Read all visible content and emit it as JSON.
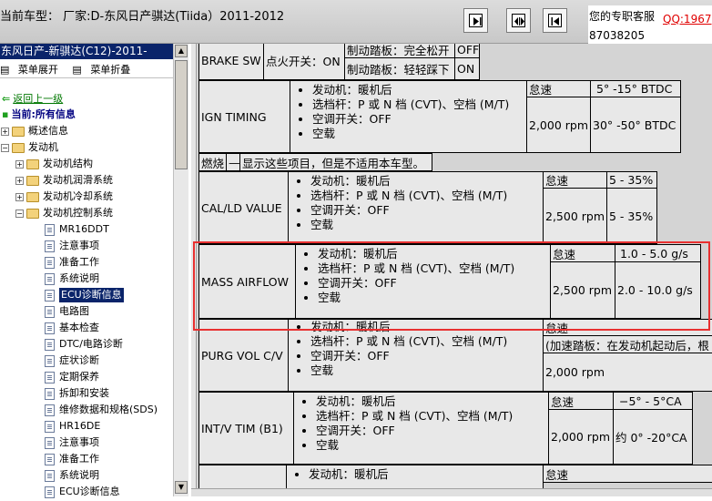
{
  "header": {
    "model_line": "当前车型：  厂家:D-东风日产骐达(Tiida）2011-2012",
    "service_label": "您的专职客服",
    "qq_text": "QQ:1967",
    "qq_number": "87038205",
    "nav_buttons": [
      "jump-next-icon",
      "jump-both-icon",
      "jump-prev-icon"
    ]
  },
  "sidebar": {
    "title": "东风日产-新骐达(C12)-2011-",
    "expand_all": "菜单展开",
    "collapse_all": "菜单折叠",
    "back_link": "返回上一级",
    "current_label": "当前:所有信息",
    "tree": [
      {
        "label": "概述信息"
      },
      {
        "label": "发动机"
      },
      {
        "label": "发动机结构"
      },
      {
        "label": "发动机润滑系统"
      },
      {
        "label": "发动机冷却系统"
      },
      {
        "label": "发动机控制系统"
      },
      {
        "label": "MR16DDT"
      },
      {
        "label": "注意事项"
      },
      {
        "label": "准备工作"
      },
      {
        "label": "系统说明"
      },
      {
        "label": "ECU诊断信息"
      },
      {
        "label": "电路图"
      },
      {
        "label": "基本检查"
      },
      {
        "label": "DTC/电路诊断"
      },
      {
        "label": "症状诊断"
      },
      {
        "label": "定期保养"
      },
      {
        "label": "拆卸和安装"
      },
      {
        "label": "维修数据和规格(SDS)"
      },
      {
        "label": "HR16DE"
      },
      {
        "label": "注意事项"
      },
      {
        "label": "准备工作"
      },
      {
        "label": "系统说明"
      },
      {
        "label": "ECU诊断信息"
      }
    ]
  },
  "content": {
    "brake_sw": {
      "item": "BRAKE SW",
      "condition": "点火开关：ON",
      "rows": [
        {
          "state": "制动踏板：完全松开",
          "value": "OFF"
        },
        {
          "state": "制动踏板：轻轻踩下",
          "value": "ON"
        }
      ]
    },
    "common_conditions": [
      "发动机：暖机后",
      "选档杆：P 或 N 档 (CVT)、空档 (M/T)",
      "空调开关：OFF",
      "空载"
    ],
    "ign_timing": {
      "item": "IGN TIMING",
      "rows": [
        {
          "cond": "怠速",
          "value": "5° -15° BTDC"
        },
        {
          "cond": "2,000 rpm",
          "value": "30° -50° BTDC"
        }
      ]
    },
    "combustion": {
      "label": "燃烧",
      "dash": "—",
      "note": "显示这些项目，但是不适用本车型。"
    },
    "cal_ld": {
      "item": "CAL/LD VALUE",
      "rows": [
        {
          "cond": "怠速",
          "value": "5 - 35%"
        },
        {
          "cond": "2,500 rpm",
          "value": "5 - 35%"
        }
      ]
    },
    "mass_airflow": {
      "item": "MASS AIRFLOW",
      "rows": [
        {
          "cond": "怠速",
          "value": "1.0 - 5.0 g/s"
        },
        {
          "cond": "2,500 rpm",
          "value": "2.0 - 10.0 g/s"
        }
      ]
    },
    "purg_vol": {
      "item": "PURG VOL C/V",
      "rows": [
        {
          "cond": "怠速"
        },
        {
          "cond": "(加速踏板：在发动机起动后，根"
        },
        {
          "cond": "2,000 rpm"
        }
      ]
    },
    "intv_tim": {
      "item": "INT/V TIM (B1)",
      "rows": [
        {
          "cond": "怠速",
          "value": "−5° - 5°CA"
        },
        {
          "cond": "2,000 rpm",
          "value": "约 0° -20°CA"
        }
      ]
    },
    "next": {
      "first_condition": "发动机：暖机后",
      "cond": "怠速"
    }
  }
}
